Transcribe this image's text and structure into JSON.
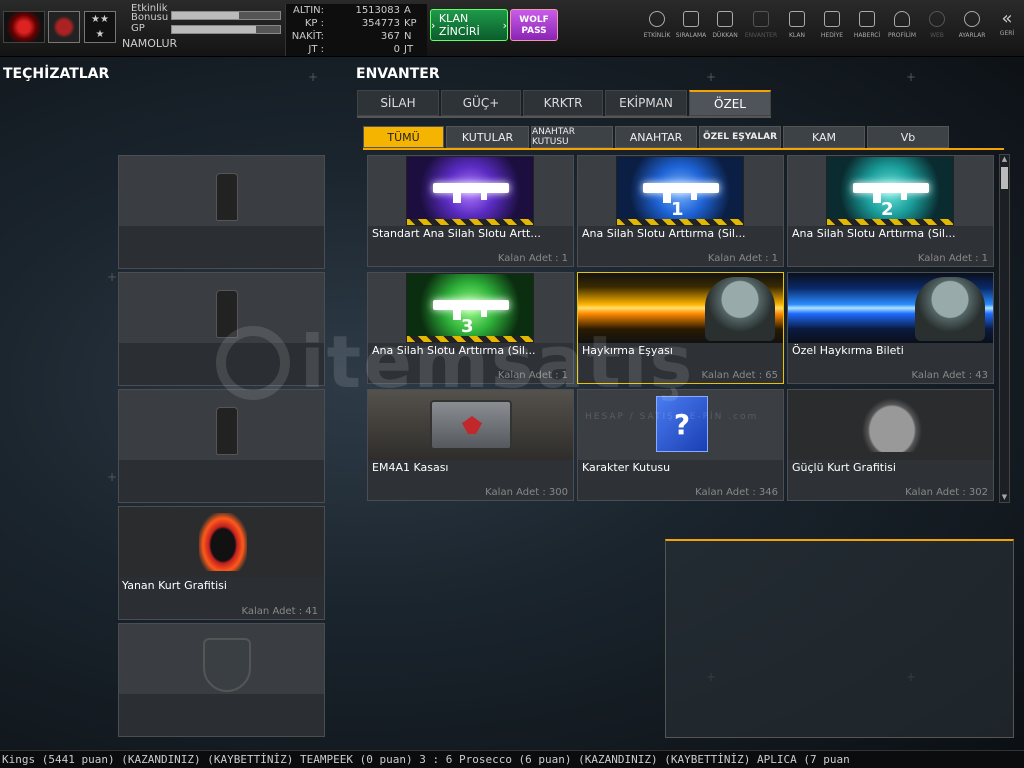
{
  "topbar": {
    "profile": {
      "bonus_label_1": "Etkinlik",
      "bonus_label_2": "Bonusu",
      "bonus_fill": 0.62,
      "gp_label": "GP",
      "gp_fill": 0.78,
      "username": "NAMOLUR"
    },
    "currency": [
      {
        "label": "ALTIN:",
        "value": "1513083",
        "unit": "A"
      },
      {
        "label": "KP :",
        "value": "354773",
        "unit": "KP"
      },
      {
        "label": "NAKİT:",
        "value": "367",
        "unit": "N"
      },
      {
        "label": "JT  :",
        "value": "0",
        "unit": "JT"
      }
    ],
    "clan_chain": "KLAN ZİNCİRİ",
    "wolf_pass_1": "WOLF",
    "wolf_pass_2": "PASS",
    "nav": [
      {
        "label": "ETKİNLİK",
        "icon": "clock-icon"
      },
      {
        "label": "SIRALAMA",
        "icon": "rank-icon"
      },
      {
        "label": "DÜKKAN",
        "icon": "cart-icon"
      },
      {
        "label": "ENVANTER",
        "icon": "inventory-icon"
      },
      {
        "label": "KLAN",
        "icon": "clan-icon"
      },
      {
        "label": "HEDİYE",
        "icon": "gift-icon"
      },
      {
        "label": "HABERCİ",
        "icon": "megaphone-icon"
      },
      {
        "label": "PROFİLİM",
        "icon": "profile-icon"
      },
      {
        "label": "WEB",
        "icon": "globe-icon"
      },
      {
        "label": "AYARLAR",
        "icon": "gear-icon"
      },
      {
        "label": "GERİ",
        "icon": "back-icon"
      }
    ]
  },
  "left": {
    "title": "TEÇHİZATLAR",
    "slots": [
      {
        "name": "",
        "count": ""
      },
      {
        "name": "",
        "count": ""
      },
      {
        "name": "",
        "count": ""
      },
      {
        "name": "Yanan Kurt Grafitisi",
        "count": "Kalan Adet : 41"
      },
      {
        "name": "",
        "count": ""
      }
    ]
  },
  "inventory": {
    "title": "ENVANTER",
    "tabs": [
      "SİLAH",
      "GÜÇ+",
      "KRKTR",
      "EKİPMAN",
      "ÖZEL"
    ],
    "active_tab": "ÖZEL",
    "subtabs": [
      "TÜMÜ",
      "KUTULAR",
      "ANAHTAR KUTUSU",
      "ANAHTAR",
      "ÖZEL EŞYALAR",
      "KAM",
      "Vb"
    ],
    "active_subtab": "TÜMÜ",
    "items": [
      {
        "name": "Standart Ana Silah Slotu Artt...",
        "count": "Kalan Adet : 1",
        "badge": ""
      },
      {
        "name": "Ana Silah Slotu Arttırma (Sil...",
        "count": "Kalan Adet : 1",
        "badge": "1"
      },
      {
        "name": "Ana Silah Slotu Arttırma (Sil...",
        "count": "Kalan Adet : 1",
        "badge": "2"
      },
      {
        "name": "Ana Silah Slotu Arttırma (Sil...",
        "count": "Kalan Adet : 1",
        "badge": "3"
      },
      {
        "name": "Haykırma Eşyası",
        "count": "Kalan Adet : 65",
        "badge": ""
      },
      {
        "name": "Özel Haykırma Bileti",
        "count": "Kalan Adet : 43",
        "badge": ""
      },
      {
        "name": "EM4A1 Kasası",
        "count": "Kalan Adet : 300",
        "badge": ""
      },
      {
        "name": "Karakter Kutusu",
        "count": "Kalan Adet : 346",
        "badge": ""
      },
      {
        "name": "Güçlü Kurt Grafitisi",
        "count": "Kalan Adet : 302",
        "badge": ""
      }
    ],
    "scroll_position": 0.0
  },
  "watermark": {
    "text": "itemsatış",
    "sub": "HESAP / SATIŞ / E-PİN .com"
  },
  "ticker": "Kings (5441 puan) (KAZANDINIZ)    (KAYBETTİNİZ) TEAMPEEK (0 puan) 3 : 6 Prosecco (6 puan) (KAZANDINIZ)         (KAYBETTİNİZ) APLICA (7 puan",
  "colors": {
    "accent": "#f4a300",
    "green_button": "#1e9a4a",
    "purple_button": "#b040d8"
  }
}
